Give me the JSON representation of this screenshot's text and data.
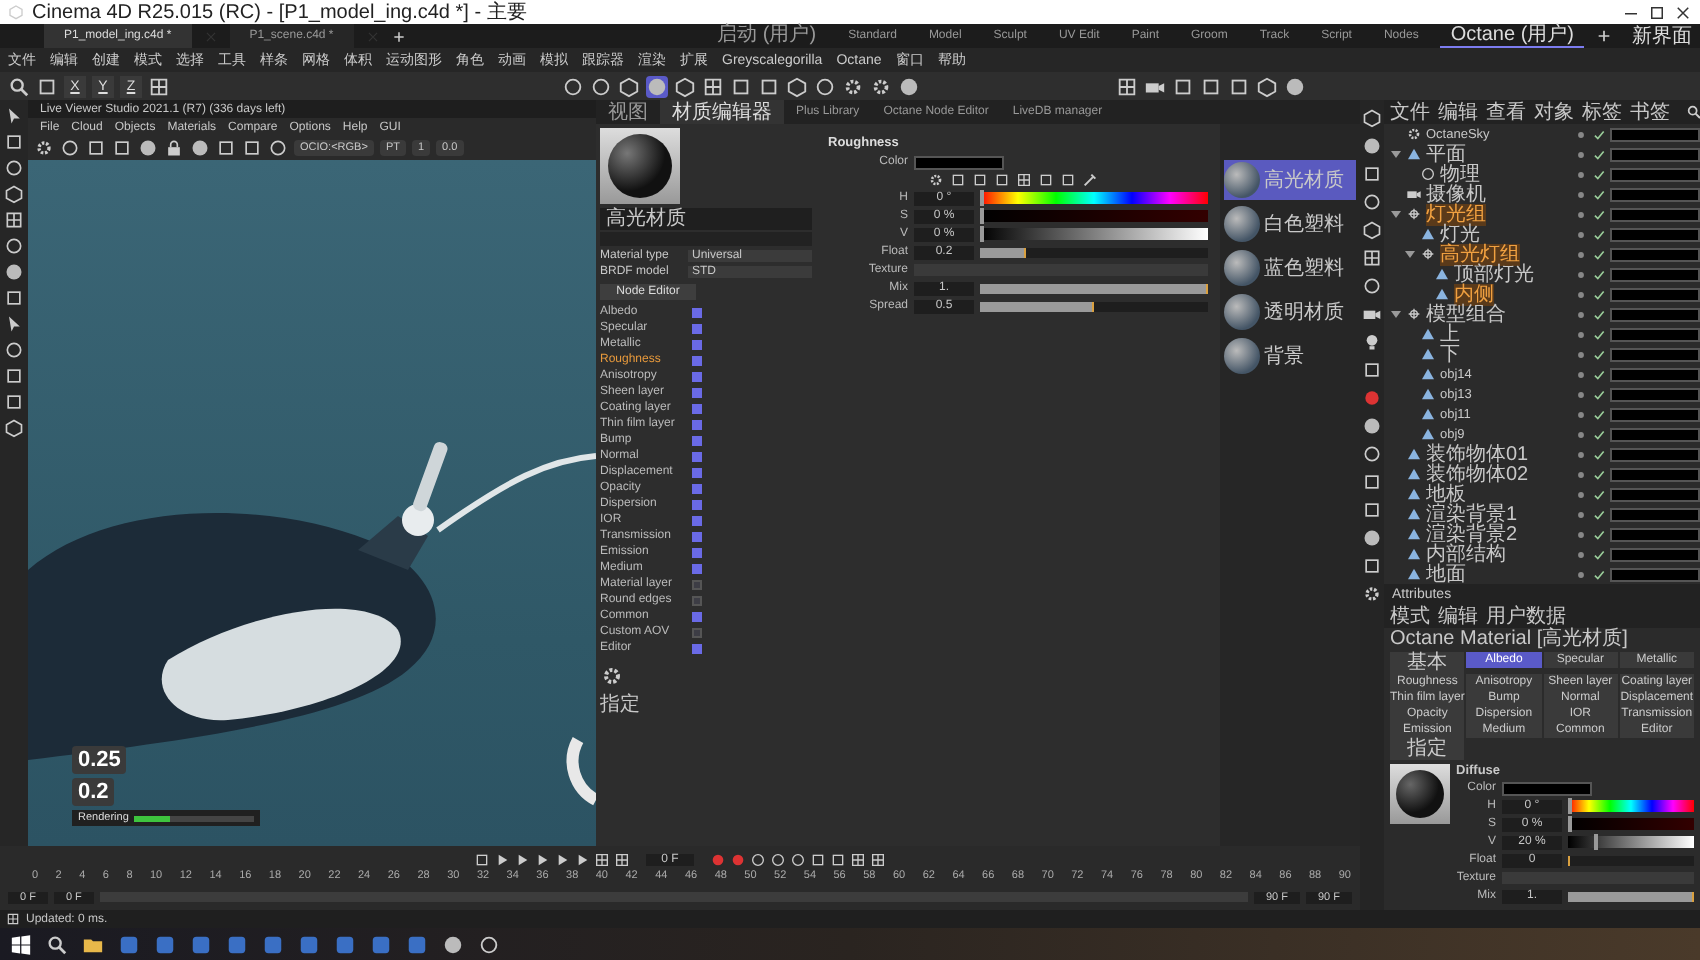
{
  "window": {
    "title": "Cinema 4D R25.015 (RC) - [P1_model_ing.c4d *] - 主要"
  },
  "document_tabs": [
    {
      "label": "P1_model_ing.c4d *",
      "selected": true
    },
    {
      "label": "P1_scene.c4d *",
      "selected": false
    }
  ],
  "layouts": [
    {
      "label": "启动 (用户)",
      "selected": false
    },
    {
      "label": "Standard",
      "selected": false
    },
    {
      "label": "Model",
      "selected": false
    },
    {
      "label": "Sculpt",
      "selected": false
    },
    {
      "label": "UV Edit",
      "selected": false
    },
    {
      "label": "Paint",
      "selected": false
    },
    {
      "label": "Groom",
      "selected": false
    },
    {
      "label": "Track",
      "selected": false
    },
    {
      "label": "Script",
      "selected": false
    },
    {
      "label": "Nodes",
      "selected": false
    },
    {
      "label": "Octane (用户)",
      "selected": true
    }
  ],
  "new_layout_button": "新界面",
  "menu": [
    "文件",
    "编辑",
    "创建",
    "模式",
    "选择",
    "工具",
    "样条",
    "网格",
    "体积",
    "运动图形",
    "角色",
    "动画",
    "模拟",
    "跟踪器",
    "渲染",
    "扩展",
    "Greyscalegorilla",
    "Octane",
    "窗口",
    "帮助"
  ],
  "axis_buttons": [
    "X",
    "Y",
    "Z"
  ],
  "viewer": {
    "title": "Live Viewer Studio 2021.1 (R7) (336 days left)",
    "menu": [
      "File",
      "Cloud",
      "Objects",
      "Materials",
      "Compare",
      "Options",
      "Help",
      "GUI"
    ],
    "color_space": "OCIO:<RGB>",
    "render_kernel": "PT",
    "fields": [
      "1",
      "0.0"
    ],
    "readouts": [
      "0.25",
      "0.2"
    ],
    "progress": {
      "label": "Rendering",
      "level": 0.3
    }
  },
  "material_editor": {
    "tabs": [
      {
        "label": "视图",
        "selected": false
      },
      {
        "label": "材质编辑器",
        "selected": true
      },
      {
        "label": "Plus Library",
        "selected": false
      },
      {
        "label": "Octane Node Editor",
        "selected": false
      },
      {
        "label": "LiveDB manager",
        "selected": false
      }
    ],
    "material_name": "高光材质",
    "properties": [
      {
        "label": "Material type",
        "value": "Universal"
      },
      {
        "label": "BRDF model",
        "value": "STD"
      }
    ],
    "node_editor_button": "Node Editor",
    "channels": [
      {
        "label": "Albedo",
        "checked": true,
        "selected": false
      },
      {
        "label": "Specular",
        "checked": true,
        "selected": false
      },
      {
        "label": "Metallic",
        "checked": true,
        "selected": false
      },
      {
        "label": "Roughness",
        "checked": true,
        "selected": true
      },
      {
        "label": "Anisotropy",
        "checked": true,
        "selected": false
      },
      {
        "label": "Sheen layer",
        "checked": true,
        "selected": false
      },
      {
        "label": "Coating layer",
        "checked": true,
        "selected": false
      },
      {
        "label": "Thin film layer",
        "checked": true,
        "selected": false
      },
      {
        "label": "Bump",
        "checked": true,
        "selected": false
      },
      {
        "label": "Normal",
        "checked": true,
        "selected": false
      },
      {
        "label": "Displacement",
        "checked": true,
        "selected": false
      },
      {
        "label": "Opacity",
        "checked": true,
        "selected": false
      },
      {
        "label": "Dispersion",
        "checked": true,
        "selected": false
      },
      {
        "label": "IOR",
        "checked": true,
        "selected": false
      },
      {
        "label": "Transmission",
        "checked": true,
        "selected": false
      },
      {
        "label": "Emission",
        "checked": true,
        "selected": false
      },
      {
        "label": "Medium",
        "checked": true,
        "selected": false
      },
      {
        "label": "Material layer",
        "checked": false,
        "selected": false
      },
      {
        "label": "Round edges",
        "checked": false,
        "selected": false
      },
      {
        "label": "Common",
        "checked": true,
        "selected": false
      },
      {
        "label": "Custom AOV",
        "checked": false,
        "selected": false
      },
      {
        "label": "Editor",
        "checked": true,
        "selected": false
      }
    ],
    "assign_label": "指定",
    "section": "Roughness",
    "params": [
      {
        "kind": "color",
        "label": "Color"
      },
      {
        "kind": "hue",
        "label": "H",
        "value": "0 °",
        "level": 0
      },
      {
        "kind": "saturation",
        "label": "S",
        "value": "0 %",
        "level": 0
      },
      {
        "kind": "value",
        "label": "V",
        "value": "0 %",
        "level": 0
      },
      {
        "kind": "slider",
        "label": "Float",
        "value": "0.2",
        "level": 0.2
      },
      {
        "kind": "texture",
        "label": "Texture"
      },
      {
        "kind": "slider",
        "label": "Mix",
        "value": "1.",
        "level": 1
      },
      {
        "kind": "slider",
        "label": "Spread",
        "value": "0.5",
        "level": 0.5
      }
    ],
    "materials": [
      {
        "name": "高光材质",
        "selected": true
      },
      {
        "name": "白色塑料",
        "selected": false
      },
      {
        "name": "蓝色塑料",
        "selected": false
      },
      {
        "name": "透明材质",
        "selected": false
      },
      {
        "name": "背景",
        "selected": false
      }
    ]
  },
  "object_manager": {
    "menu": [
      "文件",
      "编辑",
      "查看",
      "对象",
      "标签",
      "书签"
    ],
    "objects": [
      {
        "name": "OctaneSky",
        "kind": "sky",
        "selected": false
      },
      {
        "name": "平面",
        "kind": "mesh",
        "selected": false,
        "expanded": true,
        "children": [
          {
            "name": "物理",
            "kind": "tag",
            "selected": false
          }
        ]
      },
      {
        "name": "摄像机",
        "kind": "camera",
        "selected": false
      },
      {
        "name": "灯光组",
        "kind": "null",
        "selected": true,
        "expanded": true,
        "children": [
          {
            "name": "灯光",
            "kind": "mesh",
            "selected": false
          },
          {
            "name": "高光灯组",
            "kind": "null",
            "selected": true,
            "expanded": true,
            "children": [
              {
                "name": "顶部灯光",
                "kind": "mesh",
                "selected": false
              },
              {
                "name": "内侧",
                "kind": "mesh",
                "selected": true
              }
            ]
          }
        ]
      },
      {
        "name": "模型组合",
        "kind": "null",
        "selected": false,
        "expanded": true,
        "children": [
          {
            "name": "上",
            "kind": "mesh",
            "selected": false
          },
          {
            "name": "下",
            "kind": "mesh",
            "selected": false
          },
          {
            "name": "obj14",
            "kind": "mesh",
            "selected": false
          },
          {
            "name": "obj13",
            "kind": "mesh",
            "selected": false
          },
          {
            "name": "obj11",
            "kind": "mesh",
            "selected": false
          },
          {
            "name": "obj9",
            "kind": "mesh",
            "selected": false
          }
        ]
      },
      {
        "name": "装饰物体01",
        "kind": "mesh",
        "selected": false
      },
      {
        "name": "装饰物体02",
        "kind": "mesh",
        "selected": false
      },
      {
        "name": "地板",
        "kind": "mesh",
        "selected": false
      },
      {
        "name": "渲染背景1",
        "kind": "mesh",
        "selected": false
      },
      {
        "name": "渲染背景2",
        "kind": "mesh",
        "selected": false
      },
      {
        "name": "内部结构",
        "kind": "mesh",
        "selected": false
      },
      {
        "name": "地面",
        "kind": "mesh",
        "selected": false
      }
    ]
  },
  "attributes": {
    "title": "Attributes",
    "menu": [
      "模式",
      "编辑",
      "用户数据"
    ],
    "object_title": "Octane Material [高光材质]",
    "tabs": [
      {
        "label": "基本",
        "selected": false
      },
      {
        "label": "Albedo",
        "selected": true
      },
      {
        "label": "Specular",
        "selected": false
      },
      {
        "label": "Metallic",
        "selected": false
      },
      {
        "label": "Roughness",
        "selected": false
      },
      {
        "label": "Anisotropy",
        "selected": false
      },
      {
        "label": "Sheen layer",
        "selected": false
      },
      {
        "label": "Coating layer",
        "selected": false
      },
      {
        "label": "Thin film layer",
        "selected": false
      },
      {
        "label": "Bump",
        "selected": false
      },
      {
        "label": "Normal",
        "selected": false
      },
      {
        "label": "Displacement",
        "selected": false
      },
      {
        "label": "Opacity",
        "selected": false
      },
      {
        "label": "Dispersion",
        "selected": false
      },
      {
        "label": "IOR",
        "selected": false
      },
      {
        "label": "Transmission",
        "selected": false
      },
      {
        "label": "Emission",
        "selected": false
      },
      {
        "label": "Medium",
        "selected": false
      },
      {
        "label": "Common",
        "selected": false
      },
      {
        "label": "Editor",
        "selected": false
      },
      {
        "label": "指定",
        "selected": false
      }
    ],
    "section": "Diffuse",
    "params": [
      {
        "kind": "color",
        "label": "Color"
      },
      {
        "kind": "hue",
        "label": "H",
        "value": "0 °",
        "level": 0
      },
      {
        "kind": "saturation",
        "label": "S",
        "value": "0 %",
        "level": 0
      },
      {
        "kind": "value",
        "label": "V",
        "value": "20 %",
        "level": 0.2
      },
      {
        "kind": "slider",
        "label": "Float",
        "value": "0",
        "level": 0
      },
      {
        "kind": "texture",
        "label": "Texture"
      },
      {
        "kind": "slider",
        "label": "Mix",
        "value": "1.",
        "level": 1
      }
    ]
  },
  "timeline": {
    "current_frame": "0 F",
    "ticks": [
      "0",
      "2",
      "4",
      "6",
      "8",
      "10",
      "12",
      "14",
      "16",
      "18",
      "20",
      "22",
      "24",
      "26",
      "28",
      "30",
      "32",
      "34",
      "36",
      "38",
      "40",
      "42",
      "44",
      "46",
      "48",
      "50",
      "52",
      "54",
      "56",
      "58",
      "60",
      "62",
      "64",
      "66",
      "68",
      "70",
      "72",
      "74",
      "76",
      "78",
      "80",
      "82",
      "84",
      "86",
      "88",
      "90"
    ],
    "start": "0 F",
    "range_start": "0 F",
    "range_end": "90 F",
    "end": "90 F"
  },
  "status_bar": "Updated: 0 ms."
}
